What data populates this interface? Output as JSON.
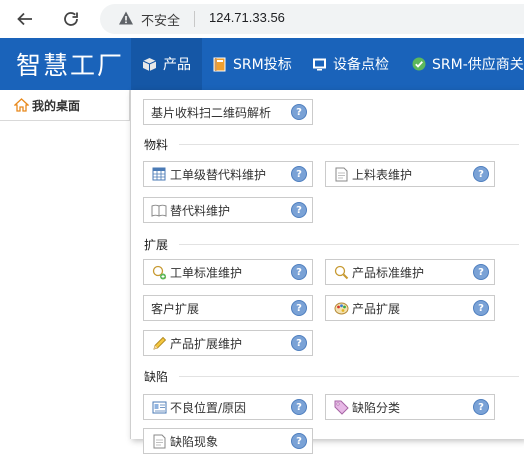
{
  "browser": {
    "security_label": "不安全",
    "url": "124.71.33.56",
    "icons": [
      "back-arrow-icon",
      "reload-icon",
      "warning-icon"
    ]
  },
  "header": {
    "brand": "智慧工厂",
    "nav": [
      {
        "label": "产品",
        "icon": "cube-icon",
        "active": true
      },
      {
        "label": "SRM投标",
        "icon": "book-icon"
      },
      {
        "label": "设备点检",
        "icon": "monitor-icon"
      },
      {
        "label": "SRM-供应商关",
        "icon": "check-circle-icon"
      }
    ]
  },
  "tabs": {
    "desktop_label": "我的桌面"
  },
  "menu": {
    "top_item": {
      "label": "基片收料扫二维码解析"
    },
    "sections": [
      {
        "title": "物料",
        "items": [
          {
            "label": "工单级替代料维护",
            "icon": "table-icon"
          },
          {
            "label": "上料表维护",
            "icon": "document-icon"
          },
          {
            "label": "替代料维护",
            "icon": "open-book-icon"
          }
        ]
      },
      {
        "title": "扩展",
        "items": [
          {
            "label": "工单标准维护",
            "icon": "search-add-icon"
          },
          {
            "label": "产品标准维护",
            "icon": "magnifier-icon"
          },
          {
            "label": "客户扩展",
            "icon": ""
          },
          {
            "label": "产品扩展",
            "icon": "palette-icon"
          },
          {
            "label": "产品扩展维护",
            "icon": "pencil-icon"
          }
        ]
      },
      {
        "title": "缺陷",
        "items": [
          {
            "label": "不良位置/原因",
            "icon": "id-card-icon"
          },
          {
            "label": "缺陷分类",
            "icon": "tag-icon"
          },
          {
            "label": "缺陷现象",
            "icon": "document-icon"
          }
        ]
      }
    ],
    "help_glyph": "?"
  },
  "colors": {
    "header_bg": "#1a63ba",
    "help_bg": "#7aa2d6"
  }
}
